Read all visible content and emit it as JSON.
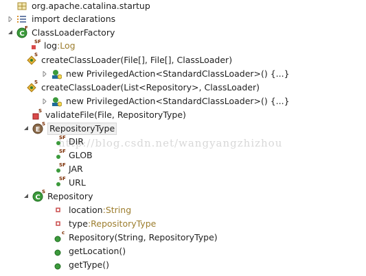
{
  "watermark": "http://blog.csdn.net/wangyangzhizhou",
  "tree": {
    "package": "org.apache.catalina.startup",
    "imports": "import declarations",
    "class_factory": "ClassLoaderFactory",
    "field_log": "log",
    "field_log_type": "Log",
    "method_create1": "createClassLoader(File[], File[], ClassLoader)",
    "anon1": "new PrivilegedAction<StandardClassLoader>() {...}",
    "method_create2": "createClassLoader(List<Repository>, ClassLoader)",
    "anon2": "new PrivilegedAction<StandardClassLoader>() {...}",
    "method_validate": "validateFile(File, RepositoryType)",
    "enum_repo_type": "RepositoryType",
    "const_dir": "DIR",
    "const_glob": "GLOB",
    "const_jar": "JAR",
    "const_url": "URL",
    "class_repository": "Repository",
    "field_location": "location",
    "field_location_type": "String",
    "field_type": "type",
    "field_type_type": "RepositoryType",
    "ctor_repository": "Repository(String, RepositoryType)",
    "method_get_location": "getLocation()",
    "method_get_type": "getType()"
  },
  "separator": " : ",
  "icons": {
    "package": "package-icon",
    "imports": "imports-icon",
    "class": "class-icon",
    "enum": "enum-icon",
    "field_static": "static-field-icon",
    "method_protected": "protected-method-icon",
    "method_private": "private-method-icon",
    "field_private": "private-field-icon",
    "method_public": "public-method-icon",
    "anonymous": "anonymous-class-icon"
  }
}
